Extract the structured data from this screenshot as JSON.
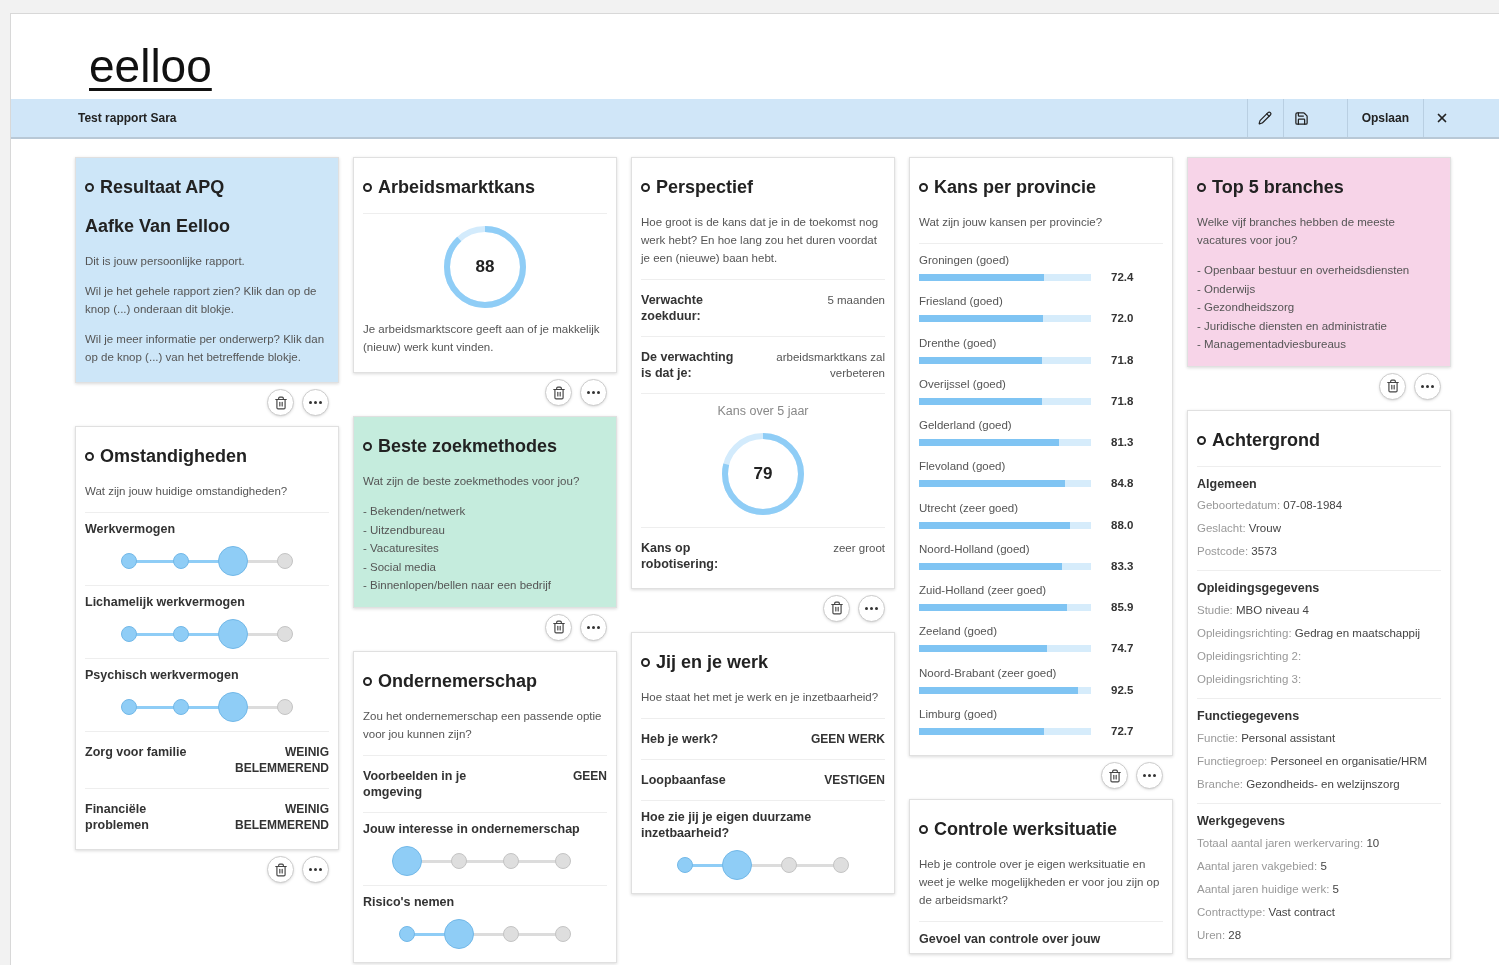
{
  "logo": "eelloo",
  "toolbar": {
    "title": "Test rapport Sara",
    "save_label": "Opslaan"
  },
  "columns": [
    {
      "cards": [
        {
          "title": "Resultaat APQ",
          "color": "#cde6f8",
          "footer": true,
          "sections": [
            {
              "kind": "heading",
              "text": "Aafke Van Eelloo"
            },
            {
              "kind": "text",
              "text": "Dit is jouw persoonlijke rapport."
            },
            {
              "kind": "text",
              "text": "Wil je het gehele rapport zien? Klik dan op de knop (...) onderaan dit blokje."
            },
            {
              "kind": "text",
              "text": "Wil je meer informatie per onderwerp? Klik dan op de knop (...) van het betreffende blokje."
            }
          ]
        },
        {
          "title": "Omstandigheden",
          "color": "#ffffff",
          "footer": true,
          "sections": [
            {
              "kind": "text",
              "text": "Wat zijn jouw huidige omstandigheden?"
            },
            {
              "kind": "slider",
              "label": "Werkvermogen",
              "level": 0.667
            },
            {
              "kind": "slider",
              "label": "Lichamelijk werkvermogen",
              "level": 0.667
            },
            {
              "kind": "slider",
              "label": "Psychisch werkvermogen",
              "level": 0.667
            },
            {
              "kind": "pair-strong",
              "label": "Zorg voor familie",
              "value": "WEINIG BELEMMEREND"
            },
            {
              "kind": "pair-strong",
              "label": "Financiële problemen",
              "value": "WEINIG BELEMMEREND"
            }
          ]
        }
      ]
    },
    {
      "cards": [
        {
          "title": "Arbeidsmarktkans",
          "color": "#ffffff",
          "footer": true,
          "sections": [
            {
              "kind": "donut",
              "value": "88",
              "level": 0.88
            },
            {
              "kind": "text",
              "text": "Je arbeidsmarktscore geeft aan of je makkelijk (nieuw) werk kunt vinden."
            }
          ]
        },
        {
          "title": "Beste zoekmethodes",
          "color": "#c5ecdd",
          "footer": true,
          "sections": [
            {
              "kind": "text",
              "text": "Wat zijn de beste zoekmethodes voor jou?"
            },
            {
              "kind": "list",
              "items": [
                "- Bekenden/netwerk",
                "- Uitzendbureau",
                "- Vacaturesites",
                "- Social media",
                "- Binnenlopen/bellen naar een bedrijf"
              ]
            }
          ]
        },
        {
          "title": "Ondernemerschap",
          "color": "#ffffff",
          "footer": false,
          "sections": [
            {
              "kind": "text",
              "text": "Zou het ondernemerschap een passende optie voor jou kunnen zijn?"
            },
            {
              "kind": "pair-strong",
              "label": "Voorbeelden in je omgeving",
              "value": "GEEN"
            },
            {
              "kind": "slider",
              "label": "Jouw interesse in ondernemerschap",
              "level": 0
            },
            {
              "kind": "slider",
              "label": "Risico's nemen",
              "level": 0.333
            }
          ]
        }
      ]
    },
    {
      "cards": [
        {
          "title": "Perspectief",
          "color": "#ffffff",
          "footer": true,
          "sections": [
            {
              "kind": "text",
              "text": "Hoe groot is de kans dat je in de toekomst nog werk hebt? En hoe lang zou het duren voordat je een (nieuwe) baan hebt."
            },
            {
              "kind": "pair",
              "label": "Verwachte zoekduur:",
              "value": "5 maanden"
            },
            {
              "kind": "pair",
              "label": "De verwachting is dat je:",
              "value": "arbeidsmarktkans zal verbeteren"
            },
            {
              "kind": "donut",
              "caption": "Kans over 5 jaar",
              "value": "79",
              "level": 0.79
            },
            {
              "kind": "pair",
              "label": "Kans op robotisering:",
              "value": "zeer groot"
            }
          ]
        },
        {
          "title": "Jij en je werk",
          "color": "#ffffff",
          "footer": false,
          "sections": [
            {
              "kind": "text",
              "text": "Hoe staat het met je werk en je inzetbaarheid?"
            },
            {
              "kind": "pair-strong",
              "label": "Heb je werk?",
              "value": "GEEN WERK"
            },
            {
              "kind": "pair-strong",
              "label": "Loopbaanfase",
              "value": "VESTIGEN"
            },
            {
              "kind": "slider",
              "label": "Hoe zie jij je eigen duurzame inzetbaarheid?",
              "level": 0.333
            }
          ]
        }
      ]
    },
    {
      "cards": [
        {
          "title": "Kans per provincie",
          "color": "#ffffff",
          "footer": true,
          "sections": [
            {
              "kind": "text",
              "text": "Wat zijn jouw kansen per provincie?"
            },
            {
              "kind": "bars",
              "rows": [
                {
                  "label": "Groningen (goed)",
                  "reading": "72.4",
                  "level": 0.724
                },
                {
                  "label": "Friesland (goed)",
                  "reading": "72.0",
                  "level": 0.72
                },
                {
                  "label": "Drenthe (goed)",
                  "reading": "71.8",
                  "level": 0.718
                },
                {
                  "label": "Overijssel (goed)",
                  "reading": "71.8",
                  "level": 0.718
                },
                {
                  "label": "Gelderland (goed)",
                  "reading": "81.3",
                  "level": 0.813
                },
                {
                  "label": "Flevoland (goed)",
                  "reading": "84.8",
                  "level": 0.848
                },
                {
                  "label": "Utrecht (zeer goed)",
                  "reading": "88.0",
                  "level": 0.88
                },
                {
                  "label": "Noord-Holland (goed)",
                  "reading": "83.3",
                  "level": 0.833
                },
                {
                  "label": "Zuid-Holland (zeer goed)",
                  "reading": "85.9",
                  "level": 0.859
                },
                {
                  "label": "Zeeland (goed)",
                  "reading": "74.7",
                  "level": 0.747
                },
                {
                  "label": "Noord-Brabant (zeer goed)",
                  "reading": "92.5",
                  "level": 0.925
                },
                {
                  "label": "Limburg (goed)",
                  "reading": "72.7",
                  "level": 0.727
                }
              ]
            }
          ]
        },
        {
          "title": "Controle werksituatie",
          "color": "#ffffff",
          "footer": false,
          "sections": [
            {
              "kind": "text",
              "text": "Heb je controle over je eigen werksituatie en weet je welke mogelijkheden er voor jou zijn op de arbeidsmarkt?"
            },
            {
              "kind": "label",
              "text": "Gevoel van controle over jouw"
            }
          ]
        }
      ]
    },
    {
      "cards": [
        {
          "title": "Top 5 branches",
          "color": "#f7d4e8",
          "footer": true,
          "sections": [
            {
              "kind": "text",
              "text": "Welke vijf branches hebben de meeste vacatures voor jou?"
            },
            {
              "kind": "list",
              "items": [
                "- Openbaar bestuur en overheidsdiensten",
                "- Onderwijs",
                "- Gezondheidszorg",
                "- Juridische diensten en administratie",
                "- Managementadviesbureaus"
              ]
            }
          ]
        },
        {
          "title": "Achtergrond",
          "color": "#ffffff",
          "footer": false,
          "sections": [
            {
              "kind": "group",
              "title": "Algemeen",
              "lines": [
                {
                  "label": "Geboortedatum:",
                  "value": "07-08-1984"
                },
                {
                  "label": "Geslacht:",
                  "value": "Vrouw"
                },
                {
                  "label": "Postcode:",
                  "value": "3573"
                }
              ]
            },
            {
              "kind": "group",
              "title": "Opleidingsgegevens",
              "lines": [
                {
                  "label": "Studie:",
                  "value": "MBO niveau 4"
                },
                {
                  "label": "Opleidingsrichting:",
                  "value": "Gedrag en maatschappij"
                },
                {
                  "label": "Opleidingsrichting 2:"
                },
                {
                  "label": "Opleidingsrichting 3:"
                }
              ]
            },
            {
              "kind": "group",
              "title": "Functiegegevens",
              "lines": [
                {
                  "label": "Functie:",
                  "value": "Personal assistant"
                },
                {
                  "label": "Functiegroep:",
                  "value": "Personeel en organisatie/HRM"
                },
                {
                  "label": "Branche:",
                  "value": "Gezondheids- en welzijnszorg"
                }
              ]
            },
            {
              "kind": "group",
              "title": "Werkgegevens",
              "lines": [
                {
                  "label": "Totaal aantal jaren werkervaring:",
                  "value": "10"
                },
                {
                  "label": "Aantal jaren vakgebied:",
                  "value": "5"
                },
                {
                  "label": "Aantal jaren huidige werk:",
                  "value": "5"
                },
                {
                  "label": "Contracttype:",
                  "value": "Vast contract"
                },
                {
                  "label": "Uren:",
                  "value": "28"
                }
              ]
            }
          ]
        }
      ]
    }
  ]
}
